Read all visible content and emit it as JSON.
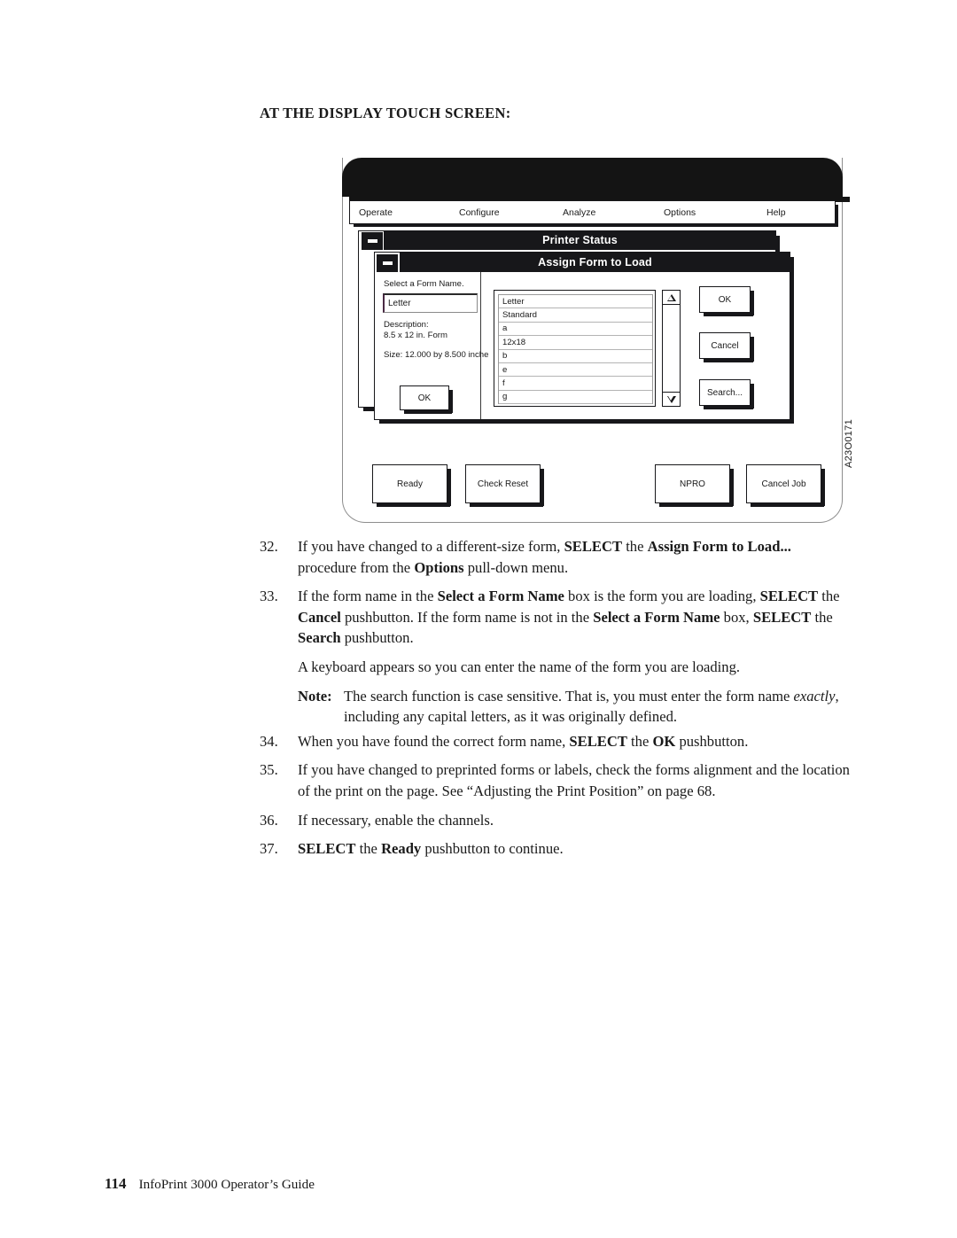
{
  "heading": "AT THE DISPLAY TOUCH SCREEN:",
  "figure": {
    "id_label": "A23O0171",
    "menubar": [
      {
        "label": "Operate"
      },
      {
        "label": "Configure"
      },
      {
        "label": "Analyze"
      },
      {
        "label": "Options"
      },
      {
        "label": "Help"
      }
    ],
    "printer_status_window": {
      "title": "Printer Status",
      "minimize_icon": "minimize-icon",
      "ok_label": "OK"
    },
    "assign_form_window": {
      "title": "Assign Form to Load",
      "minimize_icon": "minimize-icon",
      "prompt": "Select a Form Name.",
      "form_name_value": "Letter",
      "description_label": "Description:",
      "description_value": "8.5 x 12 in. Form",
      "size_value": "Size: 12.000 by 8.500 inche",
      "list_items": [
        "Letter",
        "Standard",
        "a",
        "12x18",
        "b",
        "e",
        "f",
        "g"
      ],
      "scroll_up_icon": "triangle-up-icon",
      "scroll_down_icon": "triangle-down-icon",
      "buttons": [
        {
          "label": "OK"
        },
        {
          "label": "Cancel"
        },
        {
          "label": "Search..."
        }
      ]
    },
    "bottom_buttons": [
      {
        "label": "Ready"
      },
      {
        "label": "Check Reset"
      },
      {
        "label": "NPRO"
      },
      {
        "label": "Cancel Job"
      }
    ]
  },
  "steps": {
    "s32": {
      "num": "32.",
      "a": "If you have changed to a different-size form, ",
      "b1": "SELECT",
      "c": " the ",
      "b2": "Assign Form to Load...",
      "d": " procedure from the ",
      "b3": "Options",
      "e": " pull-down menu."
    },
    "s33": {
      "num": "33.",
      "a": "If the form name in the ",
      "b1": "Select a Form Name",
      "c": " box is the form you are loading, ",
      "b2": "SELECT",
      "d": " the ",
      "b3": "Cancel",
      "e": " pushbutton. If the form name is not in the ",
      "b4": "Select a Form Name",
      "f": " box, ",
      "b5": "SELECT",
      "g": " the ",
      "b6": "Search",
      "h": " pushbutton."
    },
    "keyboard_para": "A keyboard appears so you can enter the name of the form you are loading.",
    "note": {
      "label": "Note:",
      "a": "The search function is case sensitive. That is, you must enter the form name ",
      "i1": "exactly",
      "b": ", including any capital letters, as it was originally defined."
    },
    "s34": {
      "num": "34.",
      "a": "When you have found the correct form name, ",
      "b1": "SELECT",
      "c": " the ",
      "b2": "OK",
      "d": " pushbutton."
    },
    "s35": {
      "num": "35.",
      "a": "If you have changed to preprinted forms or labels, check the forms alignment and the location of the print on the page. See “Adjusting the Print Position” on page 68."
    },
    "s36": {
      "num": "36.",
      "a": "If necessary, enable the channels."
    },
    "s37": {
      "num": "37.",
      "b1": "SELECT",
      "a": " the ",
      "b2": "Ready",
      "c": " pushbutton to continue."
    }
  },
  "footer": {
    "page_number": "114",
    "title": "InfoPrint 3000 Operator’s Guide"
  }
}
